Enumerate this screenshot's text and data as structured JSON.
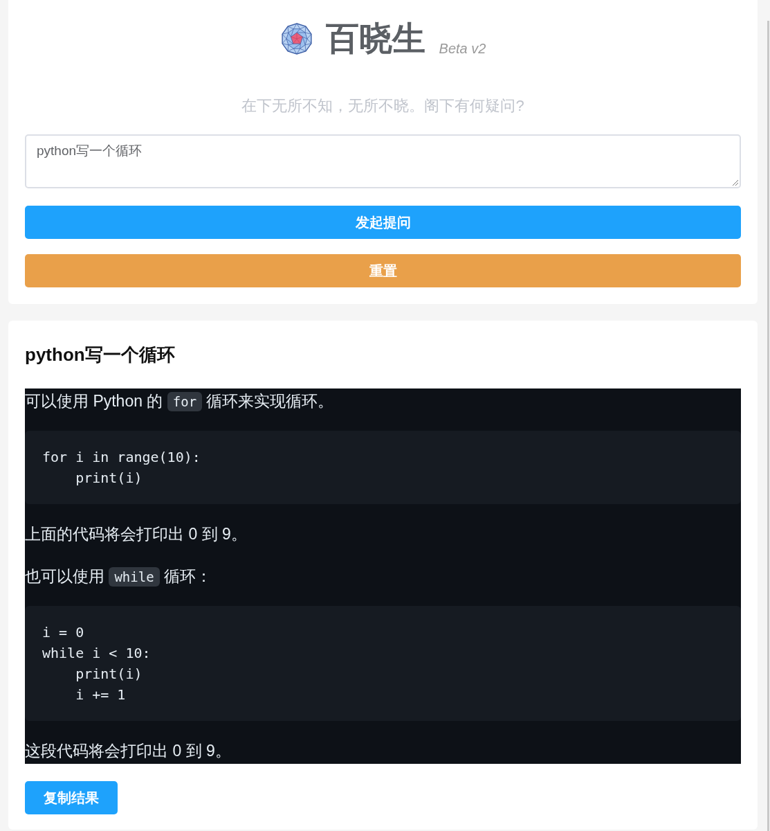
{
  "header": {
    "title": "百晓生",
    "version": "Beta v2",
    "tagline": "在下无所不知，无所不晓。阁下有何疑问?"
  },
  "question_field": {
    "value": "python写一个循环"
  },
  "buttons": [
    {
      "label": "发起提问",
      "kind": "primary"
    },
    {
      "label": "重置",
      "kind": "warning"
    }
  ],
  "answer": {
    "question": "python写一个循环",
    "blocks": [
      {
        "kind": "paragraph",
        "parts": [
          {
            "kind": "text",
            "text": "可以使用 Python 的 "
          },
          {
            "kind": "code",
            "text": "for"
          },
          {
            "kind": "text",
            "text": " 循环来实现循环。"
          }
        ]
      },
      {
        "kind": "code",
        "lines": [
          "for i in range(10):",
          "    print(i)"
        ]
      },
      {
        "kind": "paragraph",
        "parts": [
          {
            "kind": "text",
            "text": "上面的代码将会打印出 0 到 9。"
          }
        ]
      },
      {
        "kind": "paragraph",
        "parts": [
          {
            "kind": "text",
            "text": "也可以使用 "
          },
          {
            "kind": "code",
            "text": "while"
          },
          {
            "kind": "text",
            "text": " 循环："
          }
        ]
      },
      {
        "kind": "code",
        "lines": [
          "i = 0",
          "while i < 10:",
          "    print(i)",
          "    i += 1"
        ]
      },
      {
        "kind": "paragraph",
        "parts": [
          {
            "kind": "text",
            "text": "这段代码将会打印出 0 到 9。"
          }
        ]
      }
    ]
  },
  "copy_button": {
    "label": "复制结果"
  }
}
